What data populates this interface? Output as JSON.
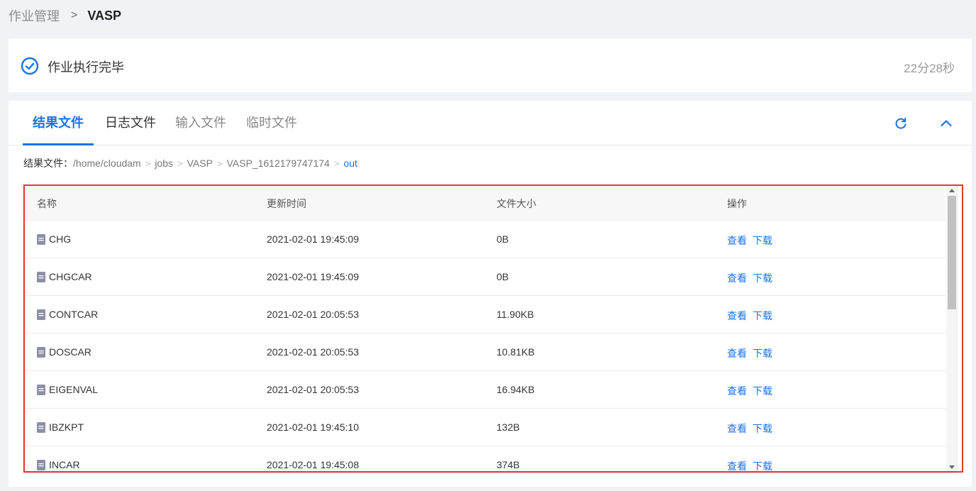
{
  "breadcrumb": {
    "parent": "作业管理",
    "separator": ">",
    "current": "VASP"
  },
  "status": {
    "text": "作业执行完毕",
    "elapsed": "22分28秒",
    "icon": "check-circle-icon",
    "color": "#1a73e8"
  },
  "tabs": [
    {
      "label": "结果文件",
      "active": true
    },
    {
      "label": "日志文件",
      "active": false
    },
    {
      "label": "输入文件",
      "active": false
    },
    {
      "label": "临时文件",
      "active": false
    }
  ],
  "toolbar": {
    "refresh_icon": "refresh-icon",
    "collapse_icon": "chevron-up-icon"
  },
  "path": {
    "label": "结果文件：",
    "segments": [
      "/home/cloudam",
      "jobs",
      "VASP",
      "VASP_1612179747174",
      "out"
    ]
  },
  "table": {
    "headers": [
      "名称",
      "更新时间",
      "文件大小",
      "操作"
    ],
    "rows": [
      {
        "name": "CHG",
        "time": "2021-02-01 19:45:09",
        "size": "0B"
      },
      {
        "name": "CHGCAR",
        "time": "2021-02-01 19:45:09",
        "size": "0B"
      },
      {
        "name": "CONTCAR",
        "time": "2021-02-01 20:05:53",
        "size": "11.90KB"
      },
      {
        "name": "DOSCAR",
        "time": "2021-02-01 20:05:53",
        "size": "10.81KB"
      },
      {
        "name": "EIGENVAL",
        "time": "2021-02-01 20:05:53",
        "size": "16.94KB"
      },
      {
        "name": "IBZKPT",
        "time": "2021-02-01 19:45:10",
        "size": "132B"
      },
      {
        "name": "INCAR",
        "time": "2021-02-01 19:45:08",
        "size": "374B"
      }
    ],
    "actions": {
      "view": "查看",
      "download": "下载"
    }
  },
  "colors": {
    "accent": "#1a73e8",
    "highlight": "#e53935"
  }
}
